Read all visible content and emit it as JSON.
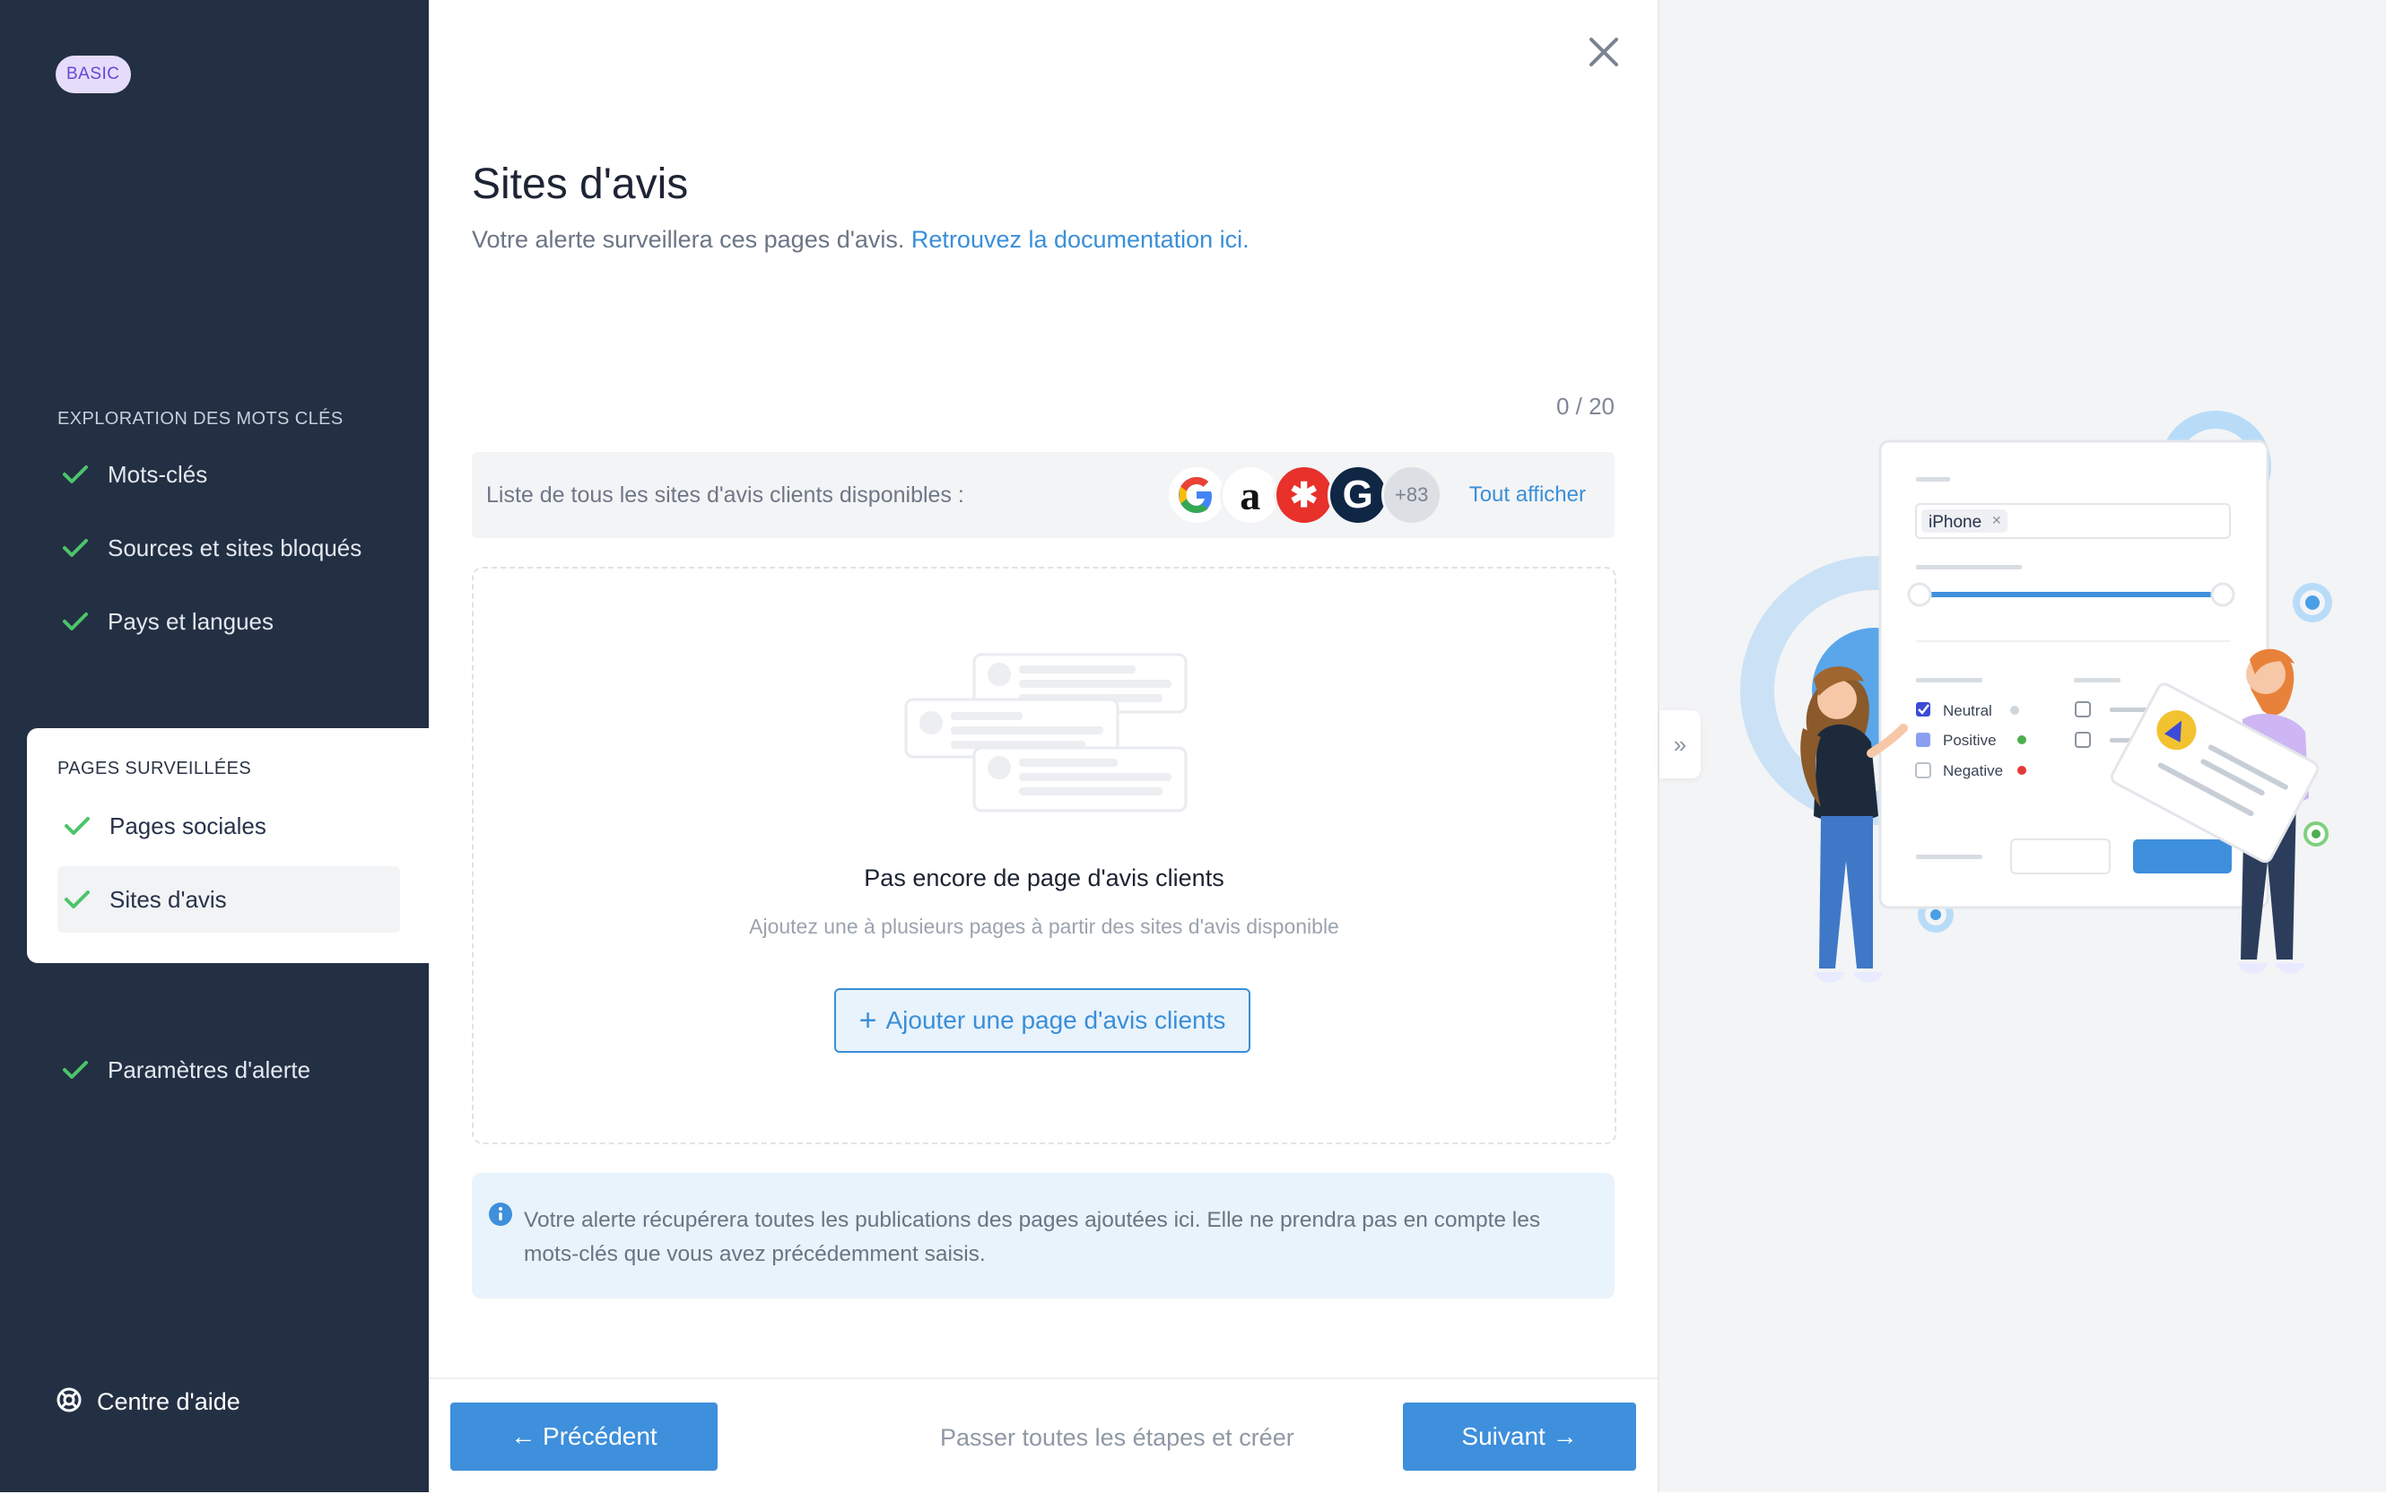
{
  "sidebar": {
    "plan_badge": "BASIC",
    "section1_title": "EXPLORATION DES MOTS CLÉS",
    "section1_items": [
      "Mots-clés",
      "Sources et sites bloqués",
      "Pays et langues"
    ],
    "section2_title": "PAGES SURVEILLÉES",
    "section2_items": [
      "Pages sociales",
      "Sites d'avis"
    ],
    "settings_item": "Paramètres d'alerte",
    "help_label": "Centre d'aide"
  },
  "main": {
    "title": "Sites d'avis",
    "subtitle": "Votre alerte surveillera ces pages d'avis.",
    "doc_link": "Retrouvez la documentation ici.",
    "counter": "0 / 20",
    "sites_bar": {
      "label": "Liste de tous les sites d'avis clients disponibles :",
      "more_count": "+83",
      "show_all": "Tout afficher",
      "logos": [
        {
          "icon": "google-logo",
          "glyph": "G",
          "color": "#4285f4",
          "bg": "#ffffff"
        },
        {
          "icon": "amazon-logo",
          "glyph": "a",
          "color": "#111111",
          "bg": "#ffffff"
        },
        {
          "icon": "yelp-logo",
          "glyph": "✱",
          "color": "#ffffff",
          "bg": "#e7312a"
        },
        {
          "icon": "glassdoor-logo",
          "glyph": "G",
          "color": "#ffffff",
          "bg": "#0f2644"
        }
      ]
    },
    "empty": {
      "title": "Pas encore de page d'avis clients",
      "subtitle": "Ajoutez une à plusieurs pages à partir des sites d'avis disponible",
      "add_button": "Ajouter une page d'avis clients"
    },
    "info": "Votre alerte récupérera toutes les publications des pages ajoutées ici. Elle ne prendra pas en compte les mots-clés que vous avez précédemment saisis.",
    "footer": {
      "prev": "← Précédent",
      "skip": "Passer toutes les étapes et créer",
      "next": "Suivant →"
    }
  },
  "illustration": {
    "search_chip": "iPhone",
    "sentiments": [
      "Neutral",
      "Positive",
      "Negative"
    ],
    "colors": {
      "accent": "#3e8fdc",
      "check": "#4caf50",
      "sidebar": "#232f43"
    }
  }
}
